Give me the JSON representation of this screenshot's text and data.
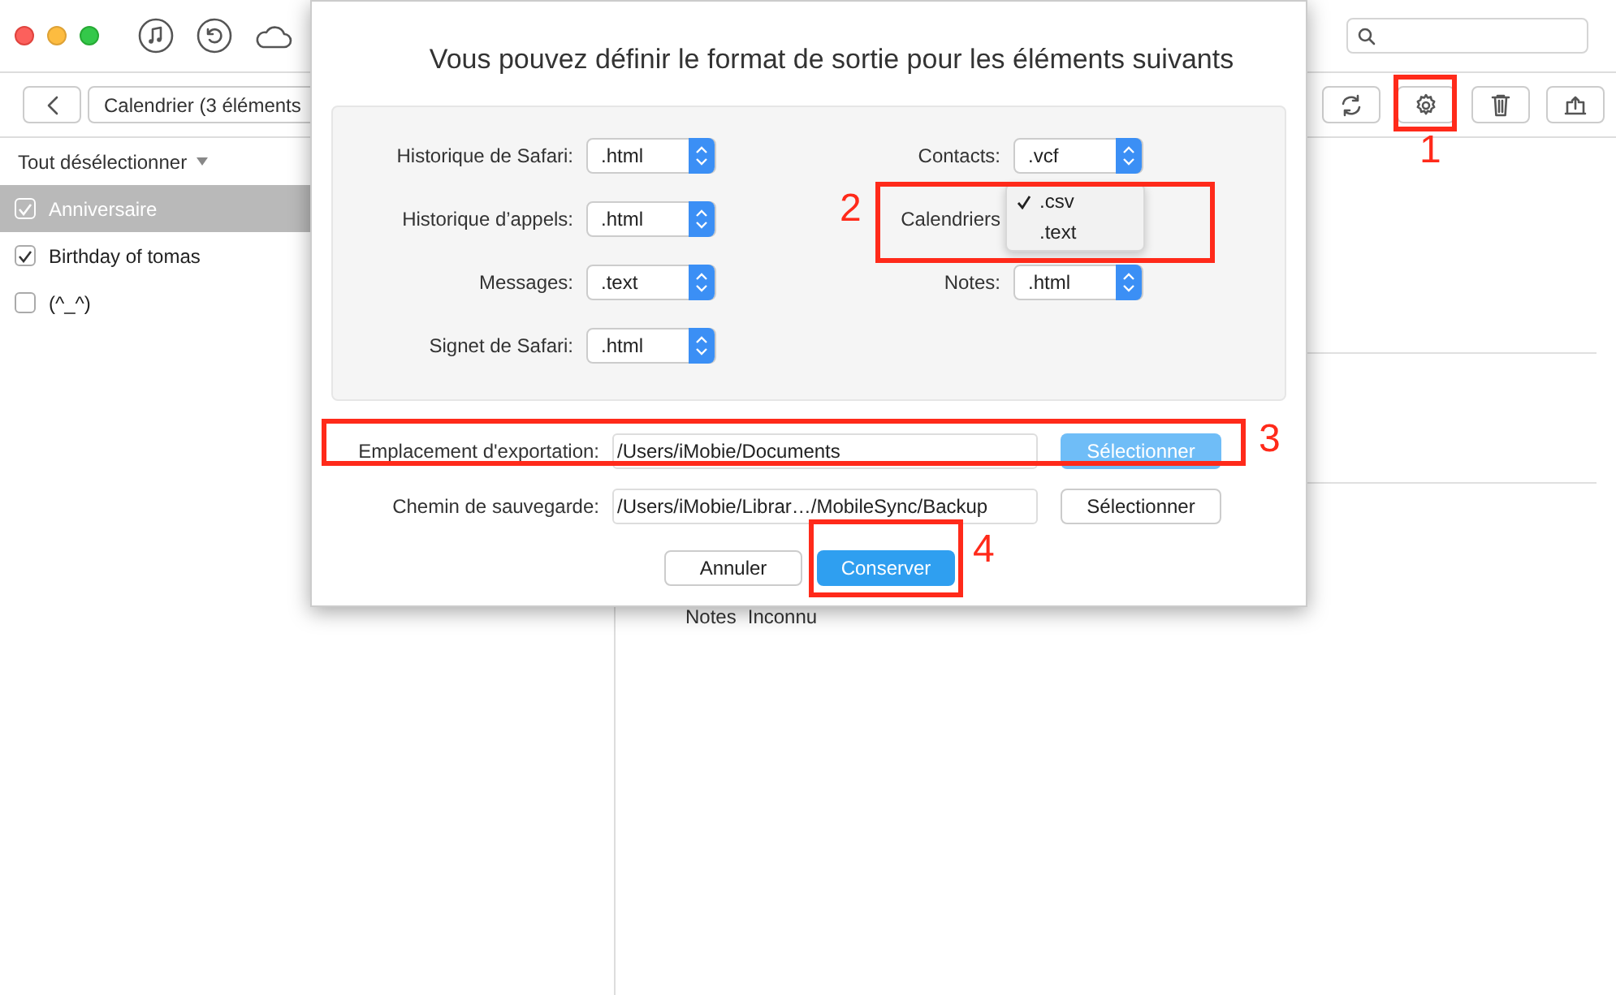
{
  "toolbar": {
    "breadcrumb": "Calendrier (3 éléments"
  },
  "list": {
    "header": "Tout désélectionner",
    "items": [
      {
        "label": "Anniversaire",
        "checked": true,
        "selected": true
      },
      {
        "label": "Birthday of tomas",
        "checked": true,
        "selected": false
      },
      {
        "label": "(^_^)",
        "checked": false,
        "selected": false
      }
    ]
  },
  "details": {
    "label": "Notes",
    "value": "Inconnu"
  },
  "dialog": {
    "title": "Vous pouvez définir le format de sortie pour les éléments suivants",
    "formats_left": [
      {
        "label": "Historique de Safari:",
        "value": ".html"
      },
      {
        "label": "Historique d’appels:",
        "value": ".html"
      },
      {
        "label": "Messages:",
        "value": ".text"
      },
      {
        "label": "Signet de Safari:",
        "value": ".html"
      }
    ],
    "formats_right": [
      {
        "label": "Contacts:",
        "value": ".vcf"
      },
      {
        "label": "Calendriers",
        "menu": [
          {
            "label": ".csv",
            "selected": true
          },
          {
            "label": ".text",
            "selected": false
          }
        ]
      },
      {
        "label": "Notes:",
        "value": ".html"
      }
    ],
    "paths": [
      {
        "label": "Emplacement d'exportation:",
        "value": "/Users/iMobie/Documents",
        "button": "Sélectionner",
        "primary": true
      },
      {
        "label": "Chemin de sauvegarde:",
        "value": "/Users/iMobie/Librar…/MobileSync/Backup",
        "button": "Sélectionner",
        "primary": false
      }
    ],
    "buttons": [
      {
        "label": "Annuler",
        "primary": false
      },
      {
        "label": "Conserver",
        "primary": true
      }
    ]
  },
  "annotations": [
    {
      "number": "1"
    },
    {
      "number": "2"
    },
    {
      "number": "3"
    },
    {
      "number": "4"
    }
  ]
}
